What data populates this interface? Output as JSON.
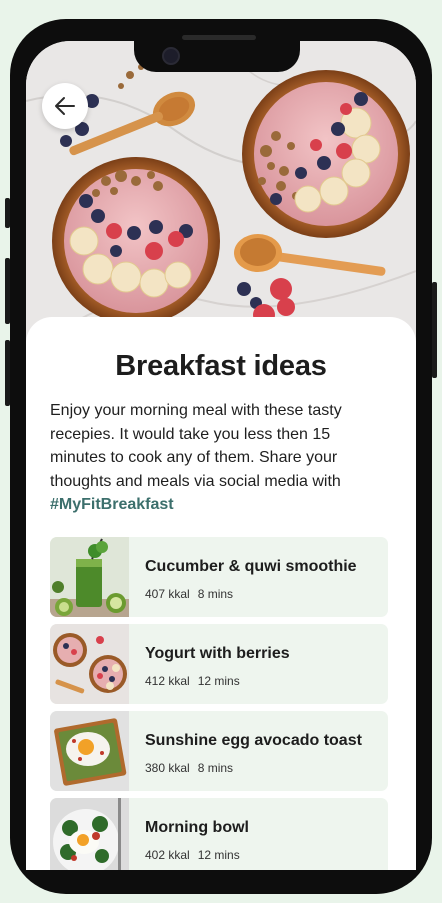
{
  "header": {
    "back_icon": "arrow-left-icon"
  },
  "article": {
    "title": "Breakfast ideas",
    "description": "Enjoy your morning meal with these tasty recepies. It would take you less then 15 minutes to cook any of them. Share your thoughts and meals via social media with",
    "hashtag": "#MyFitBreakfast"
  },
  "recipes": [
    {
      "name": "Cucumber & quwi smoothie",
      "kcal": "407 kkal",
      "time": "8 mins"
    },
    {
      "name": "Yogurt with berries",
      "kcal": "412 kkal",
      "time": "12 mins"
    },
    {
      "name": "Sunshine egg avocado toast",
      "kcal": "380 kkal",
      "time": "8 mins"
    },
    {
      "name": "Morning bowl",
      "kcal": "402 kkal",
      "time": "12 mins"
    }
  ],
  "colors": {
    "accent": "#3c6f6c",
    "card_bg": "#eef5ee",
    "page_bg": "#e9f4ea"
  }
}
